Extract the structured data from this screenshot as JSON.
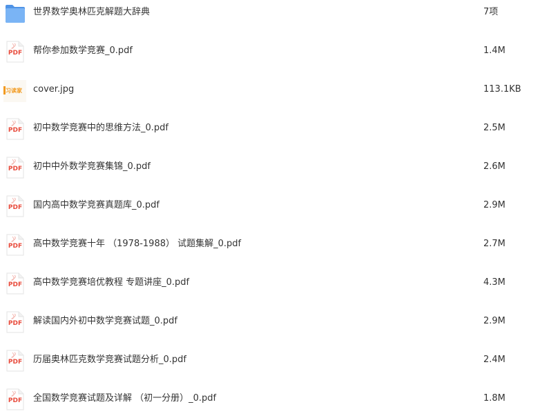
{
  "files": [
    {
      "name": "世界数学奥林匹克解题大辞典",
      "size": "7项",
      "type": "folder",
      "icon": "folder-icon"
    },
    {
      "name": "帮你参加数学竞赛_0.pdf",
      "size": "1.4M",
      "type": "pdf",
      "icon": "pdf-icon"
    },
    {
      "name": "cover.jpg",
      "size": "113.1KB",
      "type": "image",
      "icon": "image-thumbnail",
      "thumb_text": "习读家"
    },
    {
      "name": "初中数学竞赛中的思维方法_0.pdf",
      "size": "2.5M",
      "type": "pdf",
      "icon": "pdf-icon"
    },
    {
      "name": "初中中外数学竞赛集锦_0.pdf",
      "size": "2.6M",
      "type": "pdf",
      "icon": "pdf-icon"
    },
    {
      "name": "国内高中数学竞赛真题库_0.pdf",
      "size": "2.9M",
      "type": "pdf",
      "icon": "pdf-icon"
    },
    {
      "name": "高中数学竞赛十年 （1978-1988） 试题集解_0.pdf",
      "size": "2.7M",
      "type": "pdf",
      "icon": "pdf-icon"
    },
    {
      "name": "高中数学竞赛培优教程 专题讲座_0.pdf",
      "size": "4.3M",
      "type": "pdf",
      "icon": "pdf-icon"
    },
    {
      "name": "解读国内外初中数学竞赛试题_0.pdf",
      "size": "2.9M",
      "type": "pdf",
      "icon": "pdf-icon"
    },
    {
      "name": "历届奥林匹克数学竞赛试题分析_0.pdf",
      "size": "2.4M",
      "type": "pdf",
      "icon": "pdf-icon"
    },
    {
      "name": "全国数学竞赛试题及详解 （初一分册）_0.pdf",
      "size": "1.8M",
      "type": "pdf",
      "icon": "pdf-icon"
    }
  ],
  "pdf_label": "PDF",
  "colors": {
    "folder": "#6aa8f0",
    "folder_dark": "#4f93e6",
    "pdf_red": "#e84b3c",
    "text": "#333333",
    "thumb_orange": "#f29a1f"
  }
}
